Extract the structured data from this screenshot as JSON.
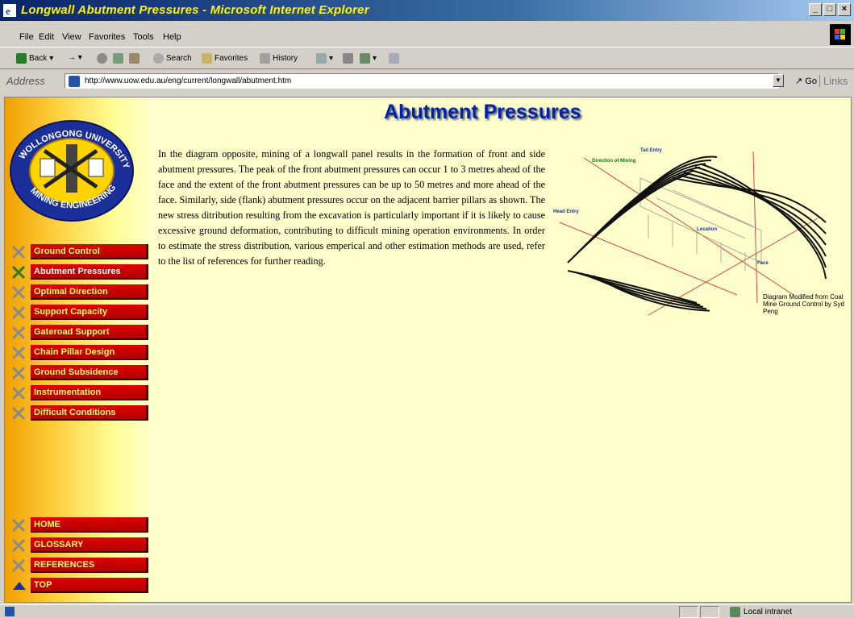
{
  "window": {
    "title": "Longwall Abutment Pressures - Microsoft Internet Explorer",
    "controls": [
      "_",
      "□",
      "×"
    ]
  },
  "menu": [
    "File",
    "Edit",
    "View",
    "Favorites",
    "Tools",
    "Help"
  ],
  "toolbar": {
    "back": "Back",
    "search": "Search",
    "favorites": "Favorites",
    "history": "History"
  },
  "address": {
    "label": "Address",
    "url": "http://www.uow.edu.au/eng/current/longwall/abutment.htm",
    "go": "Go",
    "links": "Links"
  },
  "page": {
    "heading": "Abutment Pressures",
    "body": "In the diagram opposite, mining of a longwall panel results in the formation of front and side abutment pressures. The peak of the front abutment pressures can occur 1 to 3 metres ahead of the face and the extent of the front abutment pressures can be up to 50 metres and more ahead of the face. Similarly, side (flank) abutment pressures occur on the adjacent barrier pillars as shown. The new stress ditribution resulting from the excavation is particularly important if it is likely to cause excessive ground deformation, contributing to difficult mining operation environments. In order to estimate the stress distribution, various emperical and other estimation methods are used, refer to the list of references for further reading.",
    "diagram_caption": "Diagram Modified from Coal Mine Ground Control by Syd Peng",
    "diagram_labels": {
      "direction": "Direction of Mining",
      "tail": "Tail Entry",
      "head": "Head Entry",
      "location": "Location",
      "face": "Face"
    }
  },
  "logo": {
    "top_text": "WOLLONGONG UNIVERSITY",
    "bottom_text": "MINING ENGINEERING"
  },
  "nav": {
    "items": [
      {
        "label": "Ground Control",
        "active": false
      },
      {
        "label": "Abutment Pressures",
        "active": true
      },
      {
        "label": "Optimal Direction",
        "active": false
      },
      {
        "label": "Support Capacity",
        "active": false
      },
      {
        "label": "Gateroad Support",
        "active": false
      },
      {
        "label": "Chain Pillar Design",
        "active": false
      },
      {
        "label": "Ground Subsidence",
        "active": false
      },
      {
        "label": "Instrumentation",
        "active": false
      },
      {
        "label": "Difficult Conditions",
        "active": false
      }
    ],
    "bottom": [
      {
        "label": "HOME"
      },
      {
        "label": "GLOSSARY"
      },
      {
        "label": "REFERENCES"
      },
      {
        "label": "TOP"
      }
    ]
  },
  "status": {
    "zone": "Local intranet"
  },
  "colors": {
    "page_bg": "#ffffcc",
    "nav_bg": "#cc0000",
    "nav_text": "#ffff66",
    "heading": "#0022aa",
    "title_text": "#fff200"
  }
}
